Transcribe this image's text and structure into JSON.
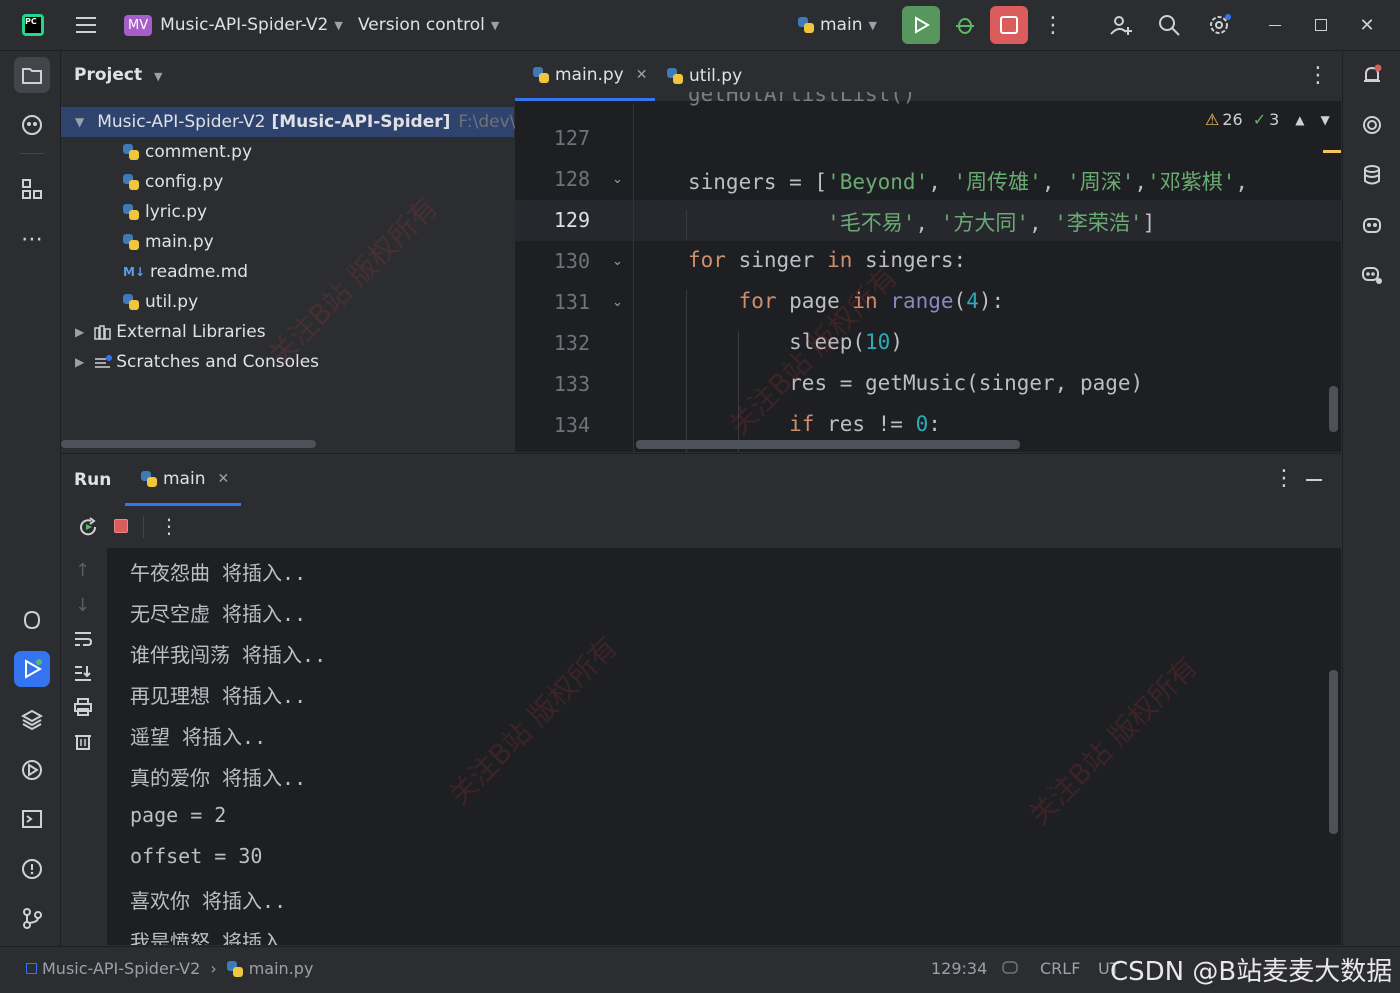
{
  "titlebar": {
    "app_badge": "MV",
    "project_name": "Music-API-Spider-V2",
    "vcs_label": "Version control",
    "run_config": "main"
  },
  "project_panel": {
    "title": "Project",
    "root_name": "Music-API-Spider-V2",
    "root_module": "[Music-API-Spider]",
    "root_path": "F:\\dev\\d",
    "files": [
      {
        "name": "comment.py",
        "type": "python"
      },
      {
        "name": "config.py",
        "type": "python"
      },
      {
        "name": "lyric.py",
        "type": "python"
      },
      {
        "name": "main.py",
        "type": "python"
      },
      {
        "name": "readme.md",
        "type": "markdown"
      },
      {
        "name": "util.py",
        "type": "python"
      }
    ],
    "external_libraries": "External Libraries",
    "scratches": "Scratches and Consoles"
  },
  "editor": {
    "tabs": [
      {
        "label": "main.py",
        "active": true
      },
      {
        "label": "util.py",
        "active": false
      }
    ],
    "warnings": "26",
    "checks": "3",
    "lines": [
      "127",
      "128",
      "129",
      "130",
      "131",
      "132",
      "133",
      "134"
    ],
    "code_line_128_start": "singers = [",
    "code_line_131_kw": "for",
    "code_line_132": "sleep(",
    "code_line_133": "res = getMusic(singer, page)"
  },
  "run_panel": {
    "title": "Run",
    "tab_label": "main",
    "output": [
      "午夜怨曲 将插入..",
      "无尽空虚 将插入..",
      "谁伴我闯荡 将插入..",
      "再见理想 将插入..",
      "遥望 将插入..",
      "真的爱你 将插入..",
      "page = 2",
      "offset = 30",
      "喜欢你 将插入..",
      "我是愤怒 将插入.."
    ]
  },
  "statusbar": {
    "breadcrumb_project": "Music-API-Spider-V2",
    "breadcrumb_file": "main.py",
    "position": "129:34",
    "line_sep": "CRLF",
    "encoding": "UT",
    "credit": "CSDN @B站麦麦大数据"
  },
  "colors": {
    "accent_blue": "#3574f0",
    "run_green": "#57965c",
    "stop_red": "#db5c5c"
  }
}
